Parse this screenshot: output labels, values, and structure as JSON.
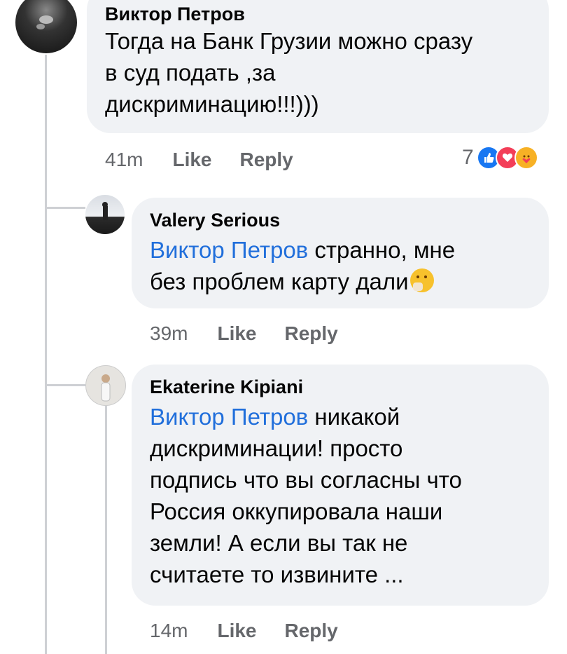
{
  "comments": [
    {
      "author": "Виктор Петров",
      "lines": [
        "Тогда на Банк Грузии можно сразу",
        "в суд подать ,за",
        "дискриминацию!!!)))"
      ],
      "time": "41m",
      "like": "Like",
      "reply": "Reply",
      "reaction_count": "7",
      "reaction_icons": [
        "like-reaction-icon",
        "love-reaction-icon",
        "care-reaction-icon"
      ]
    },
    {
      "author": "Valery Serious",
      "mention": "Виктор Петров",
      "line1_rest": " странно, мне",
      "line2": "без проблем карту дали",
      "time": "39m",
      "like": "Like",
      "reply": "Reply"
    },
    {
      "author": "Ekaterine Kipiani",
      "mention": "Виктор Петров",
      "line1_rest": " никакой",
      "lines": [
        "дискриминации! просто",
        "подпись что вы согласны что",
        "Россия оккупировала наши",
        "земли! А если вы так не",
        "считаете то  извините ..."
      ],
      "time": "14m",
      "like": "Like",
      "reply": "Reply"
    }
  ],
  "colors": {
    "mention": "#216fdb",
    "bubble": "#f0f2f5",
    "meta": "#65676b",
    "like_blue": "#1877f2",
    "love_red": "#f33e58",
    "care_yellow": "#f7b125"
  }
}
